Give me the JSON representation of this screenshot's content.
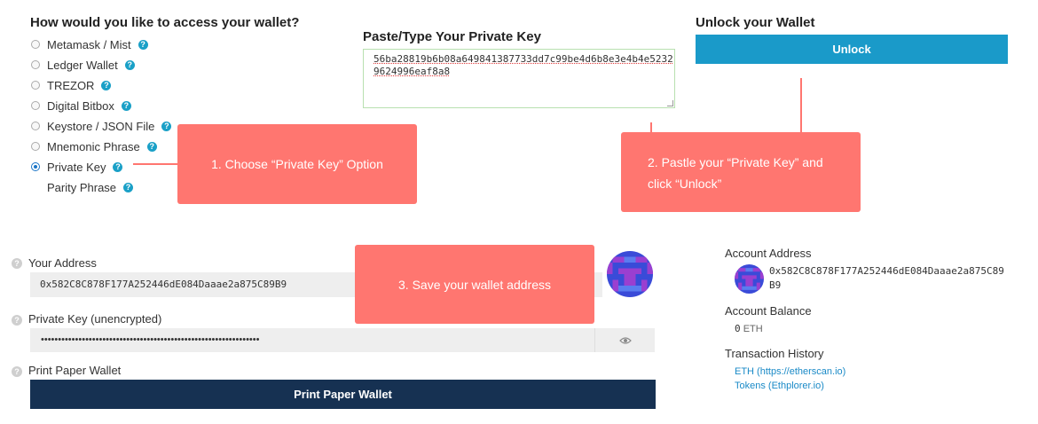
{
  "access": {
    "title": "How would you like to access your wallet?",
    "options": [
      {
        "label": "Metamask / Mist",
        "selected": false
      },
      {
        "label": "Ledger Wallet",
        "selected": false
      },
      {
        "label": "TREZOR",
        "selected": false
      },
      {
        "label": "Digital Bitbox",
        "selected": false
      },
      {
        "label": "Keystore / JSON File",
        "selected": false
      },
      {
        "label": "Mnemonic Phrase",
        "selected": false
      },
      {
        "label": "Private Key",
        "selected": true
      },
      {
        "label": "Parity Phrase",
        "selected": false
      }
    ],
    "help_glyph": "?"
  },
  "private_key_input": {
    "title": "Paste/Type Your Private Key",
    "value": "56ba28819b6b08a649841387733dd7c99be4d6b8e3e4b4e52329624996eaf8a8"
  },
  "unlock": {
    "title": "Unlock your Wallet",
    "button_label": "Unlock"
  },
  "callouts": {
    "step1": "1. Choose “Private Key” Option",
    "step2": "2. Pastle your “Private Key” and click “Unlock”",
    "step3": "3. Save your wallet address"
  },
  "wallet": {
    "address_label": "Your Address",
    "address_value": "0x582C8C878F177A252446dE084Daaae2a875C89B9",
    "private_key_label": "Private Key (unencrypted)",
    "private_key_masked": "••••••••••••••••••••••••••••••••••••••••••••••••••••••••••••••••",
    "print_label": "Print Paper Wallet",
    "print_button": "Print Paper Wallet",
    "eye_icon": "eye-icon"
  },
  "account": {
    "address_title": "Account Address",
    "address_line1": "0x582C8C878F177A252446dE084Daaae2a875C89",
    "address_line2": "B9",
    "balance_title": "Account Balance",
    "balance_value": "0",
    "balance_unit": "ETH",
    "history_title": "Transaction History",
    "links": [
      "ETH (https://etherscan.io)",
      "Tokens (Ethplorer.io)"
    ]
  },
  "colors": {
    "accent": "#1aa0c7",
    "callout": "#ff7670",
    "print_button_bg": "#163152",
    "unlock_bg": "#1a9ac9"
  }
}
